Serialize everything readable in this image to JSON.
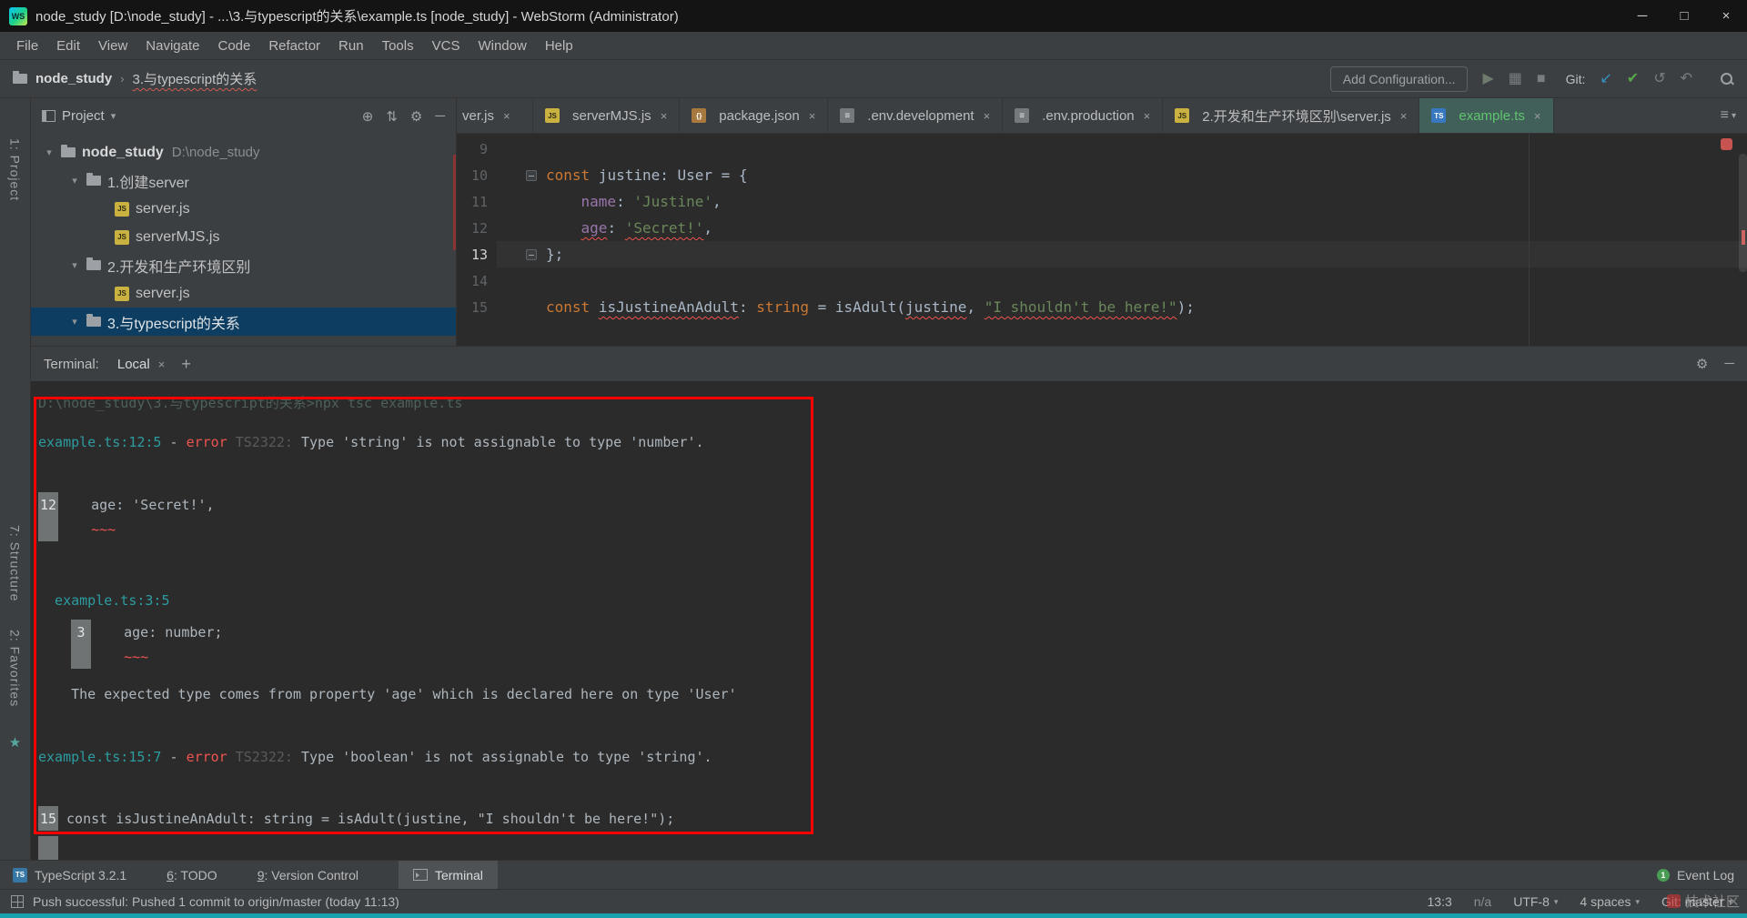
{
  "colors": {
    "annotation_red": "#fe0000",
    "error_red": "#ef5350",
    "added_file_green": "#5fc46e",
    "terminal_cyan": "#2d9ca0",
    "selection_blue": "#0d3d61",
    "commit_green": "#57a64a",
    "update_blue": "#3592c4",
    "event_badge_green": "#499c54",
    "bottom_strip_teal": "#17a2ae"
  },
  "icons": {
    "js_badge": "JS",
    "ts_badge": "TS",
    "json_badge": "{}",
    "env_badge": "≡",
    "gear": "⚙",
    "min": "─",
    "max": "□",
    "close": "×",
    "plus": "+",
    "caret_down": "▾",
    "expand_arrow": "▾",
    "crumb_sep": "›",
    "locate": "⊕",
    "collapse": "⇅",
    "run": "▶",
    "coverage": "▦",
    "stop": "■",
    "update": "↙",
    "commit": "✔",
    "history": "↺",
    "rollback": "↶",
    "list": "≡",
    "star": "★"
  },
  "titlebar": {
    "logo": "WS",
    "title": "node_study [D:\\node_study] - ...\\3.与typescript的关系\\example.ts [node_study] - WebStorm (Administrator)"
  },
  "menubar": {
    "items": [
      "File",
      "Edit",
      "View",
      "Navigate",
      "Code",
      "Refactor",
      "Run",
      "Tools",
      "VCS",
      "Window",
      "Help"
    ]
  },
  "toolbar": {
    "breadcrumb_root": "node_study",
    "breadcrumb_current": "3.与typescript的关系",
    "add_configuration": "Add Configuration...",
    "git_label": "Git:"
  },
  "left_strip": {
    "project": "1: Project",
    "structure": "7: Structure",
    "favorites": "2: Favorites"
  },
  "project_panel": {
    "title": "Project",
    "tree": [
      {
        "label": "node_study",
        "path": "D:\\node_study"
      },
      {
        "label": "1.创建server"
      },
      {
        "label": "server.js"
      },
      {
        "label": "serverMJS.js"
      },
      {
        "label": "2.开发和生产环境区别"
      },
      {
        "label": "server.js"
      },
      {
        "label": "3.与typescript的关系"
      }
    ]
  },
  "tabs": {
    "items": [
      {
        "label": "ver.js"
      },
      {
        "label": "serverMJS.js"
      },
      {
        "label": "package.json"
      },
      {
        "label": ".env.development"
      },
      {
        "label": ".env.production"
      },
      {
        "label": "2.开发和生产环境区别\\server.js"
      },
      {
        "label": "example.ts"
      }
    ]
  },
  "editor": {
    "lines": [
      {
        "n": "9"
      },
      {
        "n": "10",
        "t0": "const",
        "t1": " justine: User = {"
      },
      {
        "n": "11",
        "t0": "    ",
        "t1": "name",
        "t2": ": ",
        "t3": "'Justine'",
        "t4": ","
      },
      {
        "n": "12",
        "t0": "    ",
        "t1": "age",
        "t2": ": ",
        "t3": "'Secret!'",
        "t4": ","
      },
      {
        "n": "13",
        "t0": "};"
      },
      {
        "n": "14"
      },
      {
        "n": "15",
        "t0": "const",
        "t1": " ",
        "t2": "isJustineAnAdult",
        "t3": ": ",
        "t4": "string",
        "t5": " = ",
        "t6": "isAdult",
        "t7": "(",
        "t8": "justine",
        "t9": ", ",
        "t10": "\"I shouldn't be here!\"",
        "t11": ");"
      }
    ]
  },
  "terminal": {
    "label": "Terminal:",
    "tab": "Local",
    "output": {
      "cmd": "D:\\node_study\\3.与typescript的关系>npx tsc example.ts",
      "e1_loc": "example.ts:12:5",
      "sep": " - ",
      "err": "error",
      "e1_code": " TS2322: ",
      "e1_msg": "Type 'string' is not assignable to type 'number'.",
      "l12_num": "12",
      "l12_code": "    age: 'Secret!',",
      "l12_tilde": "    ~~~",
      "ref_loc": "  example.ts:3:5",
      "l3_num": "3",
      "l3_code": "    age: number;",
      "l3_tilde": "    ~~~",
      "expected": "    The expected type comes from property 'age' which is declared here on type 'User'",
      "e2_loc": "example.ts:15:7",
      "e2_code": " TS2322: ",
      "e2_msg": "Type 'boolean' is not assignable to type 'string'.",
      "l15_num": "15",
      "l15_code": " const isJustineAnAdult: string = isAdult(justine, \"I shouldn't be here!\");"
    }
  },
  "bottom_bar": {
    "ts_badge": "TS",
    "typescript": "TypeScript 3.2.1",
    "todo_num": "6",
    "todo_rest": ": TODO",
    "vc_num": "9",
    "vc_rest": ": Version Control",
    "terminal": "Terminal",
    "event_badge": "1",
    "event_log": "Event Log"
  },
  "status_bar": {
    "message": "Push successful: Pushed 1 commit to origin/master (today 11:13)",
    "position": "13:3",
    "line_sep": "n/a",
    "encoding": "UTF-8",
    "indent": "4 spaces",
    "git": "Git: master",
    "watermark": "技术社区"
  }
}
